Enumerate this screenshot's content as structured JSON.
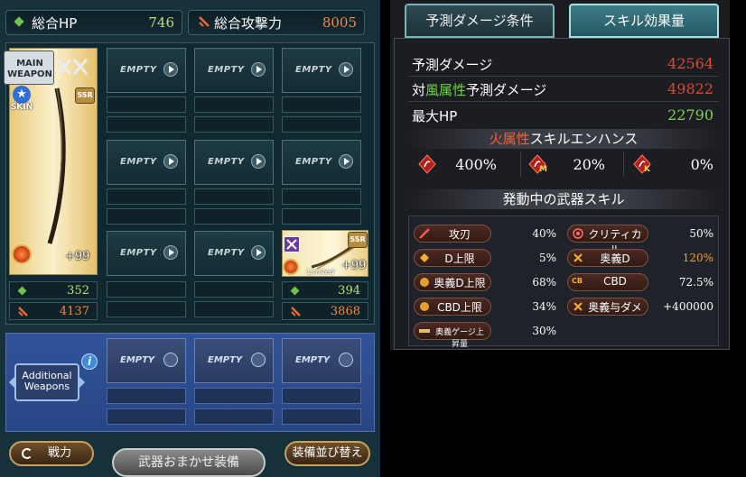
{
  "left": {
    "total_hp_label": "総合HP",
    "total_hp_value": "746",
    "total_atk_label": "総合攻撃力",
    "total_atk_value": "8005",
    "empty_label": "EMPTY",
    "main_weapon": {
      "label_line1": "MAIN",
      "label_line2": "WEAPON",
      "skin_label": "SKIN",
      "rarity": "SSR",
      "plus": "+99",
      "hp": "352",
      "atk": "4137"
    },
    "sub_weapon": {
      "rarity": "SSR",
      "plus": "+99",
      "limited": "Limited",
      "hp": "394",
      "atk": "3868"
    },
    "additional_weapons_line1": "Additional",
    "additional_weapons_line2": "Weapons",
    "info_glyph": "i",
    "battle_button": "戦力",
    "auto_equip_button": "武器おまかせ装備",
    "sort_button": "装備並び替え"
  },
  "right": {
    "tab_conditions": "予測ダメージ条件",
    "tab_skill_effect": "スキル効果量",
    "rows": [
      {
        "label": "予測ダメージ",
        "value": "42564",
        "color": "#e0482a"
      },
      {
        "label_prefix": "対",
        "label_highlight": "風属性",
        "label_suffix": "予測ダメージ",
        "value": "49822",
        "color": "#e0482a",
        "highlight_color": "#6fd24a"
      },
      {
        "label": "最大HP",
        "value": "22790",
        "color": "#7fd24a"
      }
    ],
    "enhance_header_highlight": "火属性",
    "enhance_header_rest": "スキルエンハンス",
    "enhance_highlight_color": "#ff5a3a",
    "enhance": [
      {
        "icon": "fire-crystal-icon",
        "badge": "",
        "value": "400%"
      },
      {
        "icon": "fire-crystal-m-icon",
        "badge": "M",
        "value": "20%"
      },
      {
        "icon": "fire-crystal-k-icon",
        "badge": "K",
        "value": "0%"
      }
    ],
    "active_skills_header": "発動中の武器スキル",
    "skills": [
      {
        "icon": "sword-icon",
        "name": "攻刃",
        "value": "40%"
      },
      {
        "icon": "critical-icon",
        "name": "クリティカル",
        "value": "50%"
      },
      {
        "icon": "damage-cap-icon",
        "name": "D上限",
        "value": "5%"
      },
      {
        "icon": "ougi-damage-icon",
        "name": "奥義D",
        "value": "120%",
        "value_color": "#f0a040"
      },
      {
        "icon": "ougi-cap-icon",
        "name": "奥義D上限",
        "value": "68%"
      },
      {
        "icon": "cbd-icon",
        "name": "CBD",
        "value": "72.5%",
        "badge": "CB"
      },
      {
        "icon": "cbd-cap-icon",
        "name": "CBD上限",
        "value": "34%"
      },
      {
        "icon": "ougi-bonus-icon",
        "name": "奥義与ダメ",
        "value": "+400000"
      },
      {
        "icon": "ougi-gauge-icon",
        "name": "奥義ゲージ上昇量",
        "value": "30%"
      }
    ]
  }
}
